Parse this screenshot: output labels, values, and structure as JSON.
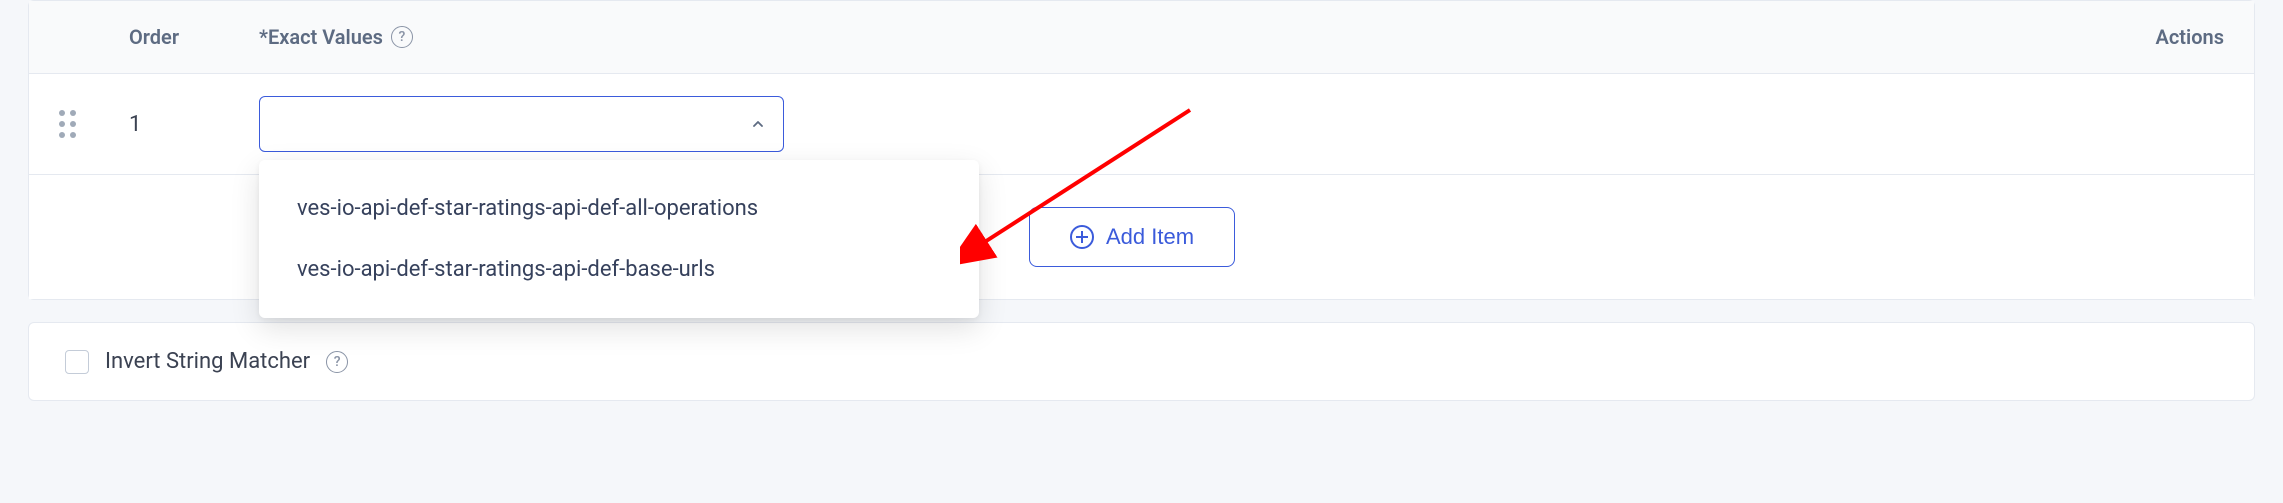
{
  "table": {
    "headers": {
      "order": "Order",
      "values": "*Exact Values",
      "actions": "Actions"
    },
    "rows": [
      {
        "order": "1",
        "value": ""
      }
    ]
  },
  "dropdown": {
    "options": [
      "ves-io-api-def-star-ratings-api-def-all-operations",
      "ves-io-api-def-star-ratings-api-def-base-urls"
    ]
  },
  "buttons": {
    "add_item": "Add Item"
  },
  "invert": {
    "label": "Invert String Matcher"
  }
}
